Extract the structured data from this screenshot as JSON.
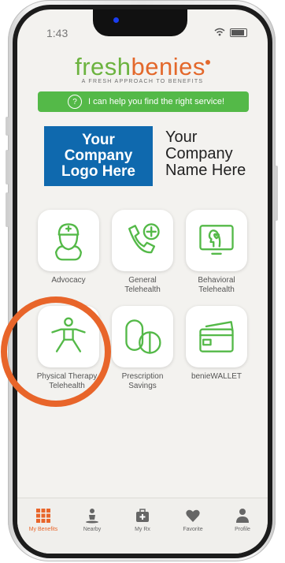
{
  "status": {
    "time": "1:43"
  },
  "brand": {
    "fresh": "fresh",
    "benies": "benies",
    "tagline": "A FRESH APPROACH TO BENEFITS"
  },
  "help_banner": {
    "icon": "question-icon",
    "text": "I can help you find the right service!"
  },
  "company": {
    "logo_lines": [
      "Your",
      "Company",
      "Logo Here"
    ],
    "name_lines": [
      "Your",
      "Company",
      "Name Here"
    ]
  },
  "services": [
    {
      "label_lines": [
        "Advocacy",
        ""
      ],
      "icon": "advocate-nurse-icon"
    },
    {
      "label_lines": [
        "General",
        "Telehealth"
      ],
      "icon": "phone-plus-icon"
    },
    {
      "label_lines": [
        "Behavioral",
        "Telehealth"
      ],
      "icon": "behavioral-head-icon"
    },
    {
      "label_lines": [
        "Physical Therapy",
        "Telehealth"
      ],
      "icon": "physical-therapy-icon"
    },
    {
      "label_lines": [
        "Prescription",
        "Savings"
      ],
      "icon": "pill-icon"
    },
    {
      "label_lines": [
        "benieWALLET",
        ""
      ],
      "icon": "wallet-card-icon"
    }
  ],
  "tabs": [
    {
      "label": "My Benefits",
      "icon": "grid-icon",
      "active": true
    },
    {
      "label": "Nearby",
      "icon": "person-pin-icon",
      "active": false
    },
    {
      "label": "My Rx",
      "icon": "medkit-icon",
      "active": false
    },
    {
      "label": "Favorite",
      "icon": "heart-icon",
      "active": false
    },
    {
      "label": "Profile",
      "icon": "profile-icon",
      "active": false
    }
  ],
  "colors": {
    "accent_green": "#54b948",
    "brand_orange": "#e3682b",
    "logo_blue": "#0f69ae",
    "ring_orange": "#e8652a"
  }
}
